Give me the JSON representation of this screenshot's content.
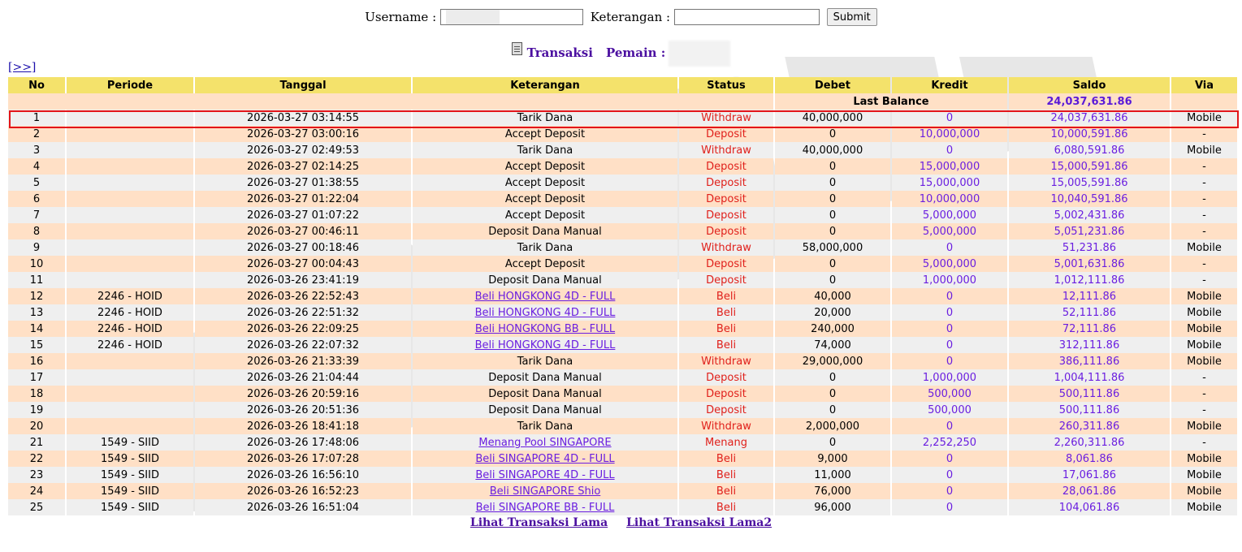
{
  "search": {
    "username_label": "Username :",
    "username_value": "",
    "keterangan_label": "Keterangan :",
    "keterangan_value": "",
    "submit_label": "Submit"
  },
  "title": {
    "transaksi": "Transaksi",
    "pemain": "Pemain :"
  },
  "nav": {
    "next": "[>>]"
  },
  "table": {
    "headers": [
      "No",
      "Periode",
      "Tanggal",
      "Keterangan",
      "Status",
      "Debet",
      "Kredit",
      "Saldo",
      "Via"
    ],
    "last_balance_label": "Last Balance",
    "last_balance_value": "24,037,631.86",
    "rows": [
      {
        "no": "1",
        "periode": "",
        "tanggal": "2026-03-27 03:14:55",
        "keterangan": "Tarik Dana",
        "link": false,
        "status": "Withdraw",
        "debet": "40,000,000",
        "kredit": "0",
        "saldo": "24,037,631.86",
        "via": "Mobile"
      },
      {
        "no": "2",
        "periode": "",
        "tanggal": "2026-03-27 03:00:16",
        "keterangan": "Accept Deposit",
        "link": false,
        "status": "Deposit",
        "debet": "0",
        "kredit": "10,000,000",
        "saldo": "10,000,591.86",
        "via": "-"
      },
      {
        "no": "3",
        "periode": "",
        "tanggal": "2026-03-27 02:49:53",
        "keterangan": "Tarik Dana",
        "link": false,
        "status": "Withdraw",
        "debet": "40,000,000",
        "kredit": "0",
        "saldo": "6,080,591.86",
        "via": "Mobile"
      },
      {
        "no": "4",
        "periode": "",
        "tanggal": "2026-03-27 02:14:25",
        "keterangan": "Accept Deposit",
        "link": false,
        "status": "Deposit",
        "debet": "0",
        "kredit": "15,000,000",
        "saldo": "15,000,591.86",
        "via": "-"
      },
      {
        "no": "5",
        "periode": "",
        "tanggal": "2026-03-27 01:38:55",
        "keterangan": "Accept Deposit",
        "link": false,
        "status": "Deposit",
        "debet": "0",
        "kredit": "15,000,000",
        "saldo": "15,005,591.86",
        "via": "-"
      },
      {
        "no": "6",
        "periode": "",
        "tanggal": "2026-03-27 01:22:04",
        "keterangan": "Accept Deposit",
        "link": false,
        "status": "Deposit",
        "debet": "0",
        "kredit": "10,000,000",
        "saldo": "10,040,591.86",
        "via": "-"
      },
      {
        "no": "7",
        "periode": "",
        "tanggal": "2026-03-27 01:07:22",
        "keterangan": "Accept Deposit",
        "link": false,
        "status": "Deposit",
        "debet": "0",
        "kredit": "5,000,000",
        "saldo": "5,002,431.86",
        "via": "-"
      },
      {
        "no": "8",
        "periode": "",
        "tanggal": "2026-03-27 00:46:11",
        "keterangan": "Deposit Dana Manual",
        "link": false,
        "status": "Deposit",
        "debet": "0",
        "kredit": "5,000,000",
        "saldo": "5,051,231.86",
        "via": "-"
      },
      {
        "no": "9",
        "periode": "",
        "tanggal": "2026-03-27 00:18:46",
        "keterangan": "Tarik Dana",
        "link": false,
        "status": "Withdraw",
        "debet": "58,000,000",
        "kredit": "0",
        "saldo": "51,231.86",
        "via": "Mobile"
      },
      {
        "no": "10",
        "periode": "",
        "tanggal": "2026-03-27 00:04:43",
        "keterangan": "Accept Deposit",
        "link": false,
        "status": "Deposit",
        "debet": "0",
        "kredit": "5,000,000",
        "saldo": "5,001,631.86",
        "via": "-"
      },
      {
        "no": "11",
        "periode": "",
        "tanggal": "2026-03-26 23:41:19",
        "keterangan": "Deposit Dana Manual",
        "link": false,
        "status": "Deposit",
        "debet": "0",
        "kredit": "1,000,000",
        "saldo": "1,012,111.86",
        "via": "-"
      },
      {
        "no": "12",
        "periode": "2246 - HOID",
        "tanggal": "2026-03-26 22:52:43",
        "keterangan": "Beli HONGKONG 4D - FULL",
        "link": true,
        "status": "Beli",
        "debet": "40,000",
        "kredit": "0",
        "saldo": "12,111.86",
        "via": "Mobile"
      },
      {
        "no": "13",
        "periode": "2246 - HOID",
        "tanggal": "2026-03-26 22:51:32",
        "keterangan": "Beli HONGKONG 4D - FULL",
        "link": true,
        "status": "Beli",
        "debet": "20,000",
        "kredit": "0",
        "saldo": "52,111.86",
        "via": "Mobile"
      },
      {
        "no": "14",
        "periode": "2246 - HOID",
        "tanggal": "2026-03-26 22:09:25",
        "keterangan": "Beli HONGKONG BB - FULL",
        "link": true,
        "status": "Beli",
        "debet": "240,000",
        "kredit": "0",
        "saldo": "72,111.86",
        "via": "Mobile"
      },
      {
        "no": "15",
        "periode": "2246 - HOID",
        "tanggal": "2026-03-26 22:07:32",
        "keterangan": "Beli HONGKONG 4D - FULL",
        "link": true,
        "status": "Beli",
        "debet": "74,000",
        "kredit": "0",
        "saldo": "312,111.86",
        "via": "Mobile"
      },
      {
        "no": "16",
        "periode": "",
        "tanggal": "2026-03-26 21:33:39",
        "keterangan": "Tarik Dana",
        "link": false,
        "status": "Withdraw",
        "debet": "29,000,000",
        "kredit": "0",
        "saldo": "386,111.86",
        "via": "Mobile"
      },
      {
        "no": "17",
        "periode": "",
        "tanggal": "2026-03-26 21:04:44",
        "keterangan": "Deposit Dana Manual",
        "link": false,
        "status": "Deposit",
        "debet": "0",
        "kredit": "1,000,000",
        "saldo": "1,004,111.86",
        "via": "-"
      },
      {
        "no": "18",
        "periode": "",
        "tanggal": "2026-03-26 20:59:16",
        "keterangan": "Deposit Dana Manual",
        "link": false,
        "status": "Deposit",
        "debet": "0",
        "kredit": "500,000",
        "saldo": "500,111.86",
        "via": "-"
      },
      {
        "no": "19",
        "periode": "",
        "tanggal": "2026-03-26 20:51:36",
        "keterangan": "Deposit Dana Manual",
        "link": false,
        "status": "Deposit",
        "debet": "0",
        "kredit": "500,000",
        "saldo": "500,111.86",
        "via": "-"
      },
      {
        "no": "20",
        "periode": "",
        "tanggal": "2026-03-26 18:41:18",
        "keterangan": "Tarik Dana",
        "link": false,
        "status": "Withdraw",
        "debet": "2,000,000",
        "kredit": "0",
        "saldo": "260,311.86",
        "via": "Mobile"
      },
      {
        "no": "21",
        "periode": "1549 - SIID",
        "tanggal": "2026-03-26 17:48:06",
        "keterangan": "Menang Pool SINGAPORE",
        "link": true,
        "status": "Menang",
        "debet": "0",
        "kredit": "2,252,250",
        "saldo": "2,260,311.86",
        "via": "-"
      },
      {
        "no": "22",
        "periode": "1549 - SIID",
        "tanggal": "2026-03-26 17:07:28",
        "keterangan": "Beli SINGAPORE 4D - FULL",
        "link": true,
        "status": "Beli",
        "debet": "9,000",
        "kredit": "0",
        "saldo": "8,061.86",
        "via": "Mobile"
      },
      {
        "no": "23",
        "periode": "1549 - SIID",
        "tanggal": "2026-03-26 16:56:10",
        "keterangan": "Beli SINGAPORE 4D - FULL",
        "link": true,
        "status": "Beli",
        "debet": "11,000",
        "kredit": "0",
        "saldo": "17,061.86",
        "via": "Mobile"
      },
      {
        "no": "24",
        "periode": "1549 - SIID",
        "tanggal": "2026-03-26 16:52:23",
        "keterangan": "Beli SINGAPORE Shio",
        "link": true,
        "status": "Beli",
        "debet": "76,000",
        "kredit": "0",
        "saldo": "28,061.86",
        "via": "Mobile"
      },
      {
        "no": "25",
        "periode": "1549 - SIID",
        "tanggal": "2026-03-26 16:51:04",
        "keterangan": "Beli SINGAPORE BB - FULL",
        "link": true,
        "status": "Beli",
        "debet": "96,000",
        "kredit": "0",
        "saldo": "104,061.86",
        "via": "Mobile"
      }
    ]
  },
  "footer": {
    "lihat_lama": "Lihat Transaksi Lama",
    "lihat_lama2": "Lihat Transaksi Lama2"
  },
  "colors": {
    "header_bg": "#f4e26b",
    "row_odd": "#efefef",
    "row_even": "#ffe0c6",
    "status_red": "#e0201b",
    "accent_purple": "#6a1ee0",
    "highlight": "#e3151a"
  }
}
